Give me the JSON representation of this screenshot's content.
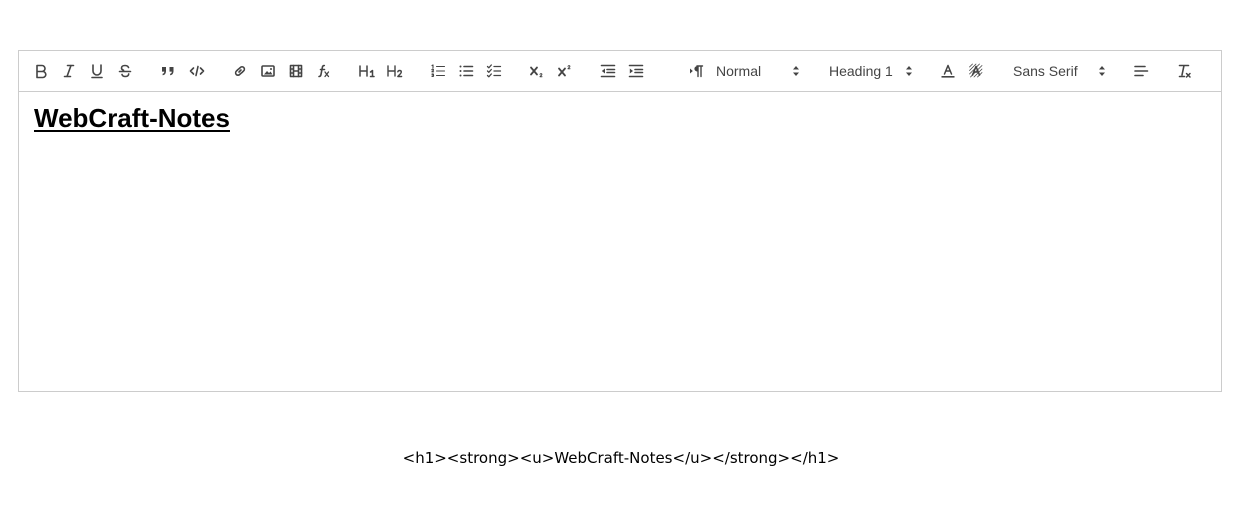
{
  "toolbar": {
    "header_picker": "Normal",
    "heading_picker": "Heading 1",
    "font_picker": "Sans Serif"
  },
  "editor": {
    "heading_text": "WebCraft-Notes"
  },
  "output": {
    "html_source": "<h1><strong><u>WebCraft-Notes</u></strong></h1>"
  }
}
